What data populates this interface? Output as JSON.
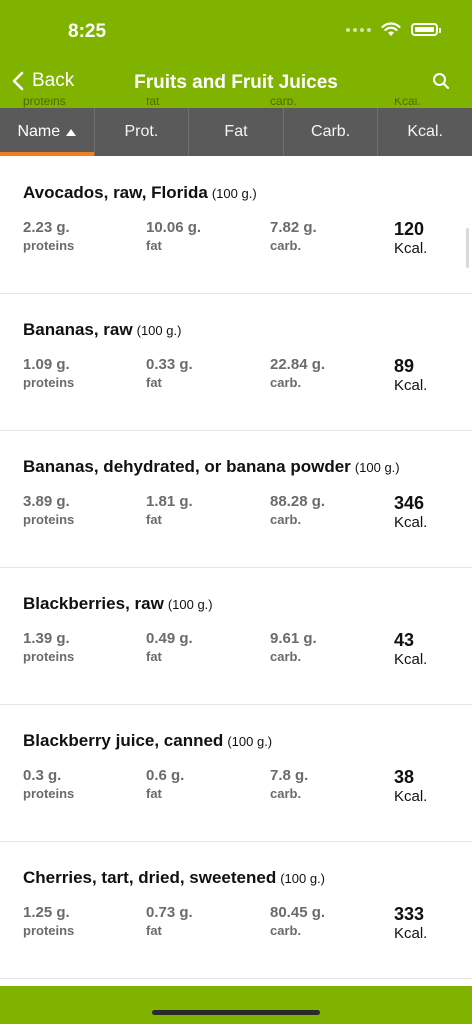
{
  "status": {
    "time": "8:25"
  },
  "nav": {
    "back_label": "Back",
    "title": "Fruits and Fruit Juices"
  },
  "ghost": {
    "proteins": "proteins",
    "fat": "fat",
    "carb": "carb.",
    "kcal": "Kcal."
  },
  "tabs": [
    {
      "label": "Name",
      "active": true
    },
    {
      "label": "Prot."
    },
    {
      "label": "Fat"
    },
    {
      "label": "Carb."
    },
    {
      "label": "Kcal."
    }
  ],
  "labels": {
    "proteins": "proteins",
    "fat": "fat",
    "carb": "carb.",
    "kcal": "Kcal."
  },
  "items": [
    {
      "name": "Avocados, raw, Florida",
      "portion": "(100 g.)",
      "proteins": "2.23 g.",
      "fat": "10.06 g.",
      "carb": "7.82 g.",
      "kcal": "120"
    },
    {
      "name": "Bananas, raw",
      "portion": "(100 g.)",
      "proteins": "1.09 g.",
      "fat": "0.33 g.",
      "carb": "22.84 g.",
      "kcal": "89"
    },
    {
      "name": "Bananas, dehydrated, or banana powder",
      "portion": "(100 g.)",
      "proteins": "3.89 g.",
      "fat": "1.81 g.",
      "carb": "88.28 g.",
      "kcal": "346"
    },
    {
      "name": "Blackberries, raw",
      "portion": "(100 g.)",
      "proteins": "1.39 g.",
      "fat": "0.49 g.",
      "carb": "9.61 g.",
      "kcal": "43"
    },
    {
      "name": "Blackberry juice, canned",
      "portion": "(100 g.)",
      "proteins": "0.3 g.",
      "fat": "0.6 g.",
      "carb": "7.8 g.",
      "kcal": "38"
    },
    {
      "name": "Cherries, tart, dried, sweetened",
      "portion": "(100 g.)",
      "proteins": "1.25 g.",
      "fat": "0.73 g.",
      "carb": "80.45 g.",
      "kcal": "333"
    }
  ],
  "colors": {
    "accent": "#7fb300",
    "tab_bg": "#5a5a5a",
    "active_underline": "#f0801e"
  }
}
